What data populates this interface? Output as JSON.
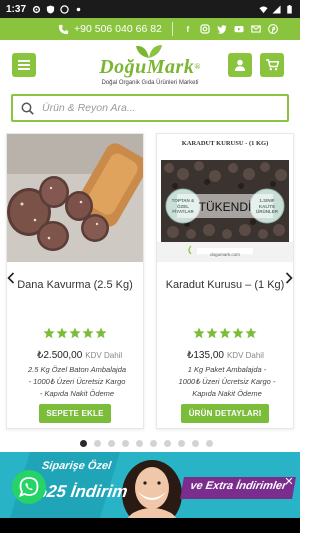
{
  "status_bar": {
    "time": "1:37"
  },
  "top_strip": {
    "phone": "+90 506 040 66 82",
    "socials": [
      "facebook-icon",
      "instagram-icon",
      "twitter-icon",
      "youtube-icon",
      "email-icon",
      "pinterest-icon"
    ]
  },
  "header": {
    "logo_word": "DoğuMark",
    "logo_reg": "®",
    "tagline": "Doğal Organik Gıda Ürünleri Marketi"
  },
  "search": {
    "placeholder": "Ürün & Reyon Ara..."
  },
  "products": [
    {
      "title": "Dana Kavurma (2.5 Kg)",
      "rating": 5,
      "price": "₺2.500,00",
      "kdv": "KDV Dahil",
      "description": "2.5 Kg Özel Baton Ambalajda - 1000₺ Üzeri Ücretsiz Kargo - Kapıda Nakit Ödeme",
      "button": "SEPETE EKLE"
    },
    {
      "title": "Karadut Kurusu – (1 Kg)",
      "image_header": "KARADUT KURUSU - (1 KG)",
      "sold_out": "TÜKENDİ",
      "badge_left": "TOPTAN & ÖZEL FİYATLAR",
      "badge_right": "1.SINIF KALİTE ÜRÜNLER",
      "image_site": "dogumark.com",
      "rating": 5,
      "price": "₺135,00",
      "kdv": "KDV Dahil",
      "description": "1 Kg Paket Ambalajda - 1000₺ Üzeri Ücretsiz Kargo - Kapıda Nakit Ödeme",
      "button": "ÜRÜN DETAYLARI"
    }
  ],
  "pager": {
    "count": 10,
    "active_index": 0
  },
  "banner": {
    "line1": "Siparişe Özel",
    "line2": "%25 İndirim",
    "line3": "ve Extra İndirimler"
  },
  "colors": {
    "brand_green": "#8ac43f",
    "button_green": "#7bbd3a",
    "banner_teal": "#29b3c7",
    "banner_purple": "#7b2d8e"
  }
}
